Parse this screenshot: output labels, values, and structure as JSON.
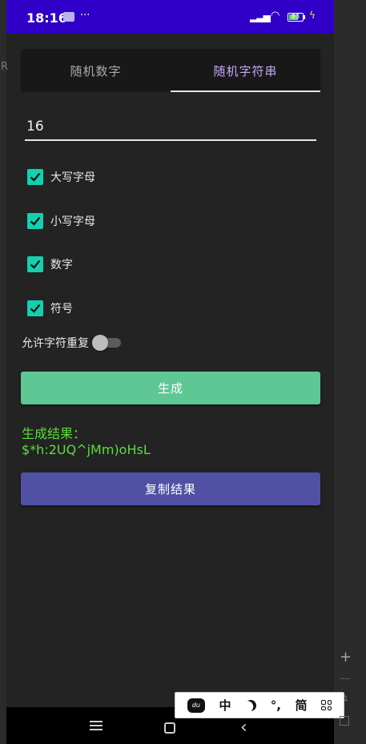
{
  "status_bar": {
    "time": "18:16",
    "notif_dots": "···",
    "battery_level": "83"
  },
  "edge_label": "R",
  "tabs": [
    {
      "label": "随机数字",
      "active": false
    },
    {
      "label": "随机字符串",
      "active": true
    }
  ],
  "length_input": {
    "value": "16"
  },
  "options": [
    {
      "label": "大写字母",
      "checked": true
    },
    {
      "label": "小写字母",
      "checked": true
    },
    {
      "label": "数字",
      "checked": true
    },
    {
      "label": "符号",
      "checked": true
    }
  ],
  "allow_repeat": {
    "label": "允许字符重复",
    "on": false
  },
  "generate_button": {
    "label": "生成"
  },
  "result": {
    "title": "生成结果：",
    "value": "$*h:2UQ^jMm)oHsL"
  },
  "copy_button": {
    "label": "复制结果"
  },
  "ime_bar": {
    "logo": "du",
    "chinese": "中",
    "punct": "°,",
    "simplified": "简"
  },
  "zoom": {
    "level": "1"
  },
  "colors": {
    "status_bar": "#3000c8",
    "checkbox": "#12d0b0",
    "generate_button": "#5ec794",
    "copy_button": "#5051a3",
    "result_text": "#5bde3b",
    "active_tab": "#c3a7f7"
  }
}
